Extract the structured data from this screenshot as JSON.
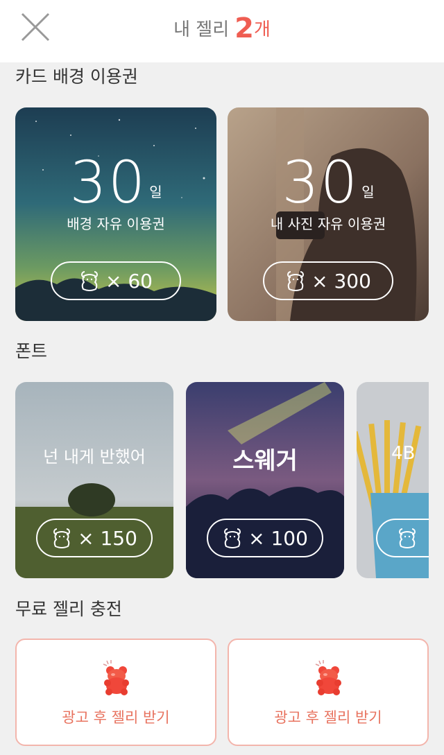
{
  "header": {
    "title_prefix": "내 젤리",
    "count": "2",
    "count_unit": "개",
    "close_icon": "close-x-icon"
  },
  "sections": {
    "background": "카드 배경 이용권",
    "font": "폰트",
    "free": "무료 젤리 충전"
  },
  "background_cards": [
    {
      "days": "30",
      "day_unit": "일",
      "name": "배경 자유 이용권",
      "price": "× 60",
      "icon": "jelly-bear-icon"
    },
    {
      "days": "30",
      "day_unit": "일",
      "name": "내 사진 자유 이용권",
      "price": "× 300",
      "icon": "jelly-bear-icon"
    }
  ],
  "font_cards": [
    {
      "sample": "넌 내게 반했어",
      "price": "× 150",
      "icon": "jelly-bear-icon"
    },
    {
      "sample": "스웨거",
      "price": "× 100",
      "icon": "jelly-bear-icon"
    },
    {
      "sample": "4B",
      "price": "",
      "icon": "jelly-bear-icon"
    }
  ],
  "free_buttons": [
    {
      "label": "광고 후 젤리 받기",
      "icon": "gummy-bear-icon"
    },
    {
      "label": "광고 후 젤리 받기",
      "icon": "gummy-bear-icon"
    }
  ],
  "colors": {
    "accent": "#ef5d52",
    "free_label": "#e8735f",
    "free_border": "#f3b5ac",
    "background": "#f0f0f0"
  }
}
